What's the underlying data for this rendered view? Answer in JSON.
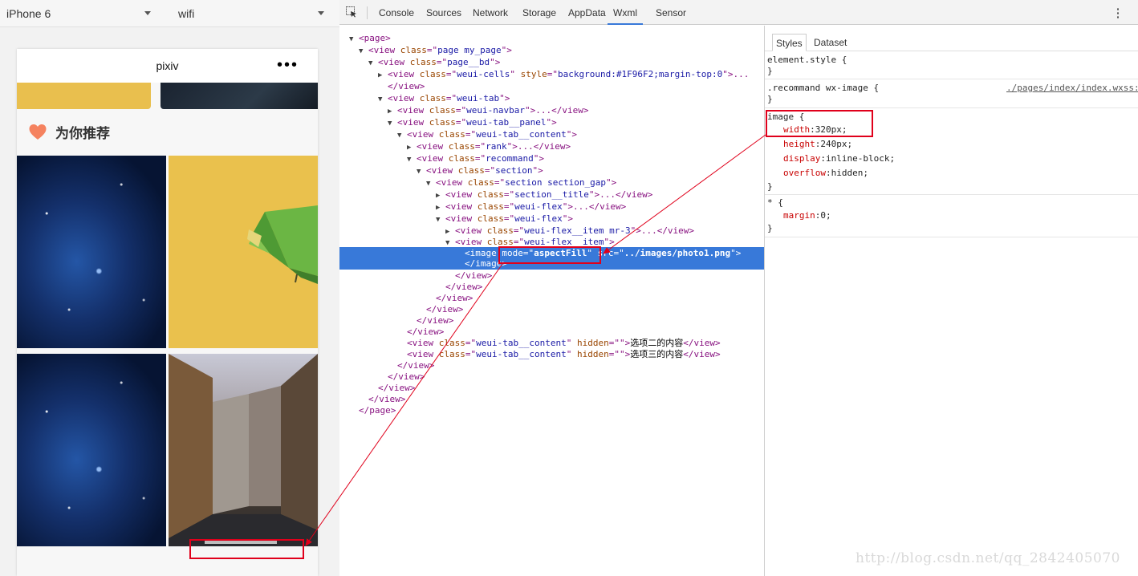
{
  "simulator": {
    "device": "iPhone 6",
    "network": "wifi",
    "page_title": "pixiv",
    "more_icon": "•••",
    "section_title": "为你推荐"
  },
  "devtools": {
    "tabs": [
      "Console",
      "Sources",
      "Network",
      "Storage",
      "AppData",
      "Wxml",
      "Sensor"
    ],
    "active_tab": "Wxml"
  },
  "wxml_tree": [
    {
      "indent": 0,
      "toggle": "▼",
      "parts": [
        [
          "tg",
          "<page>"
        ]
      ]
    },
    {
      "indent": 1,
      "toggle": "▼",
      "parts": [
        [
          "tg",
          "<view "
        ],
        [
          "an",
          "class"
        ],
        [
          "tg",
          "=\""
        ],
        [
          "av",
          "page my_page"
        ],
        [
          "tg",
          "\">"
        ]
      ]
    },
    {
      "indent": 2,
      "toggle": "▼",
      "parts": [
        [
          "tg",
          "<view "
        ],
        [
          "an",
          "class"
        ],
        [
          "tg",
          "=\""
        ],
        [
          "av",
          "page__bd"
        ],
        [
          "tg",
          "\">"
        ]
      ]
    },
    {
      "indent": 3,
      "toggle": "▶",
      "parts": [
        [
          "tg",
          "<view "
        ],
        [
          "an",
          "class"
        ],
        [
          "tg",
          "=\""
        ],
        [
          "av",
          "weui-cells"
        ],
        [
          "tg",
          "\" "
        ],
        [
          "an",
          "style"
        ],
        [
          "tg",
          "=\""
        ],
        [
          "av",
          "background:#1F96F2;margin-top:0"
        ],
        [
          "tg",
          "\">..."
        ]
      ]
    },
    {
      "indent": 3,
      "toggle": "",
      "parts": [
        [
          "tg",
          "</view>"
        ]
      ]
    },
    {
      "indent": 3,
      "toggle": "▼",
      "parts": [
        [
          "tg",
          "<view "
        ],
        [
          "an",
          "class"
        ],
        [
          "tg",
          "=\""
        ],
        [
          "av",
          "weui-tab"
        ],
        [
          "tg",
          "\">"
        ]
      ]
    },
    {
      "indent": 4,
      "toggle": "▶",
      "parts": [
        [
          "tg",
          "<view "
        ],
        [
          "an",
          "class"
        ],
        [
          "tg",
          "=\""
        ],
        [
          "av",
          "weui-navbar"
        ],
        [
          "tg",
          "\">...</view>"
        ]
      ]
    },
    {
      "indent": 4,
      "toggle": "▼",
      "parts": [
        [
          "tg",
          "<view "
        ],
        [
          "an",
          "class"
        ],
        [
          "tg",
          "=\""
        ],
        [
          "av",
          "weui-tab__panel"
        ],
        [
          "tg",
          "\">"
        ]
      ]
    },
    {
      "indent": 5,
      "toggle": "▼",
      "parts": [
        [
          "tg",
          "<view "
        ],
        [
          "an",
          "class"
        ],
        [
          "tg",
          "=\""
        ],
        [
          "av",
          "weui-tab__content"
        ],
        [
          "tg",
          "\">"
        ]
      ]
    },
    {
      "indent": 6,
      "toggle": "▶",
      "parts": [
        [
          "tg",
          "<view "
        ],
        [
          "an",
          "class"
        ],
        [
          "tg",
          "=\""
        ],
        [
          "av",
          "rank"
        ],
        [
          "tg",
          "\">...</view>"
        ]
      ]
    },
    {
      "indent": 6,
      "toggle": "▼",
      "parts": [
        [
          "tg",
          "<view "
        ],
        [
          "an",
          "class"
        ],
        [
          "tg",
          "=\""
        ],
        [
          "av",
          "recommand"
        ],
        [
          "tg",
          "\">"
        ]
      ]
    },
    {
      "indent": 7,
      "toggle": "▼",
      "parts": [
        [
          "tg",
          "<view "
        ],
        [
          "an",
          "class"
        ],
        [
          "tg",
          "=\""
        ],
        [
          "av",
          "section"
        ],
        [
          "tg",
          "\">"
        ]
      ]
    },
    {
      "indent": 8,
      "toggle": "▼",
      "parts": [
        [
          "tg",
          "<view "
        ],
        [
          "an",
          "class"
        ],
        [
          "tg",
          "=\""
        ],
        [
          "av",
          "section section_gap"
        ],
        [
          "tg",
          "\">"
        ]
      ]
    },
    {
      "indent": 9,
      "toggle": "▶",
      "parts": [
        [
          "tg",
          "<view "
        ],
        [
          "an",
          "class"
        ],
        [
          "tg",
          "=\""
        ],
        [
          "av",
          "section__title"
        ],
        [
          "tg",
          "\">...</view>"
        ]
      ]
    },
    {
      "indent": 9,
      "toggle": "▶",
      "parts": [
        [
          "tg",
          "<view "
        ],
        [
          "an",
          "class"
        ],
        [
          "tg",
          "=\""
        ],
        [
          "av",
          "weui-flex"
        ],
        [
          "tg",
          "\">...</view>"
        ]
      ]
    },
    {
      "indent": 9,
      "toggle": "▼",
      "parts": [
        [
          "tg",
          "<view "
        ],
        [
          "an",
          "class"
        ],
        [
          "tg",
          "=\""
        ],
        [
          "av",
          "weui-flex"
        ],
        [
          "tg",
          "\">"
        ]
      ]
    },
    {
      "indent": 10,
      "toggle": "▶",
      "parts": [
        [
          "tg",
          "<view "
        ],
        [
          "an",
          "class"
        ],
        [
          "tg",
          "=\""
        ],
        [
          "av",
          "weui-flex__item mr-3"
        ],
        [
          "tg",
          "\">...</view>"
        ]
      ]
    },
    {
      "indent": 10,
      "toggle": "▼",
      "parts": [
        [
          "tg",
          "<view "
        ],
        [
          "an",
          "class"
        ],
        [
          "tg",
          "=\""
        ],
        [
          "av",
          "weui-flex__item"
        ],
        [
          "tg",
          "\">"
        ]
      ]
    },
    {
      "indent": 11,
      "toggle": "",
      "selected": true,
      "parts": [
        [
          "tg",
          "<image "
        ],
        [
          "an",
          "mode"
        ],
        [
          "tg",
          "=\""
        ],
        [
          "av",
          "aspectFill"
        ],
        [
          "tg",
          "\" "
        ],
        [
          "an",
          "src"
        ],
        [
          "tg",
          "=\""
        ],
        [
          "av",
          "../images/photo1.png"
        ],
        [
          "tg",
          "\">"
        ]
      ],
      "second": [
        [
          "tg",
          "</image>"
        ]
      ]
    },
    {
      "indent": 10,
      "toggle": "",
      "parts": [
        [
          "tg",
          "</view>"
        ]
      ]
    },
    {
      "indent": 9,
      "toggle": "",
      "parts": [
        [
          "tg",
          "</view>"
        ]
      ]
    },
    {
      "indent": 8,
      "toggle": "",
      "parts": [
        [
          "tg",
          "</view>"
        ]
      ]
    },
    {
      "indent": 7,
      "toggle": "",
      "parts": [
        [
          "tg",
          "</view>"
        ]
      ]
    },
    {
      "indent": 6,
      "toggle": "",
      "parts": [
        [
          "tg",
          "</view>"
        ]
      ]
    },
    {
      "indent": 5,
      "toggle": "",
      "parts": [
        [
          "tg",
          "</view>"
        ]
      ]
    },
    {
      "indent": 5,
      "toggle": "",
      "parts": [
        [
          "tg",
          "<view "
        ],
        [
          "an",
          "class"
        ],
        [
          "tg",
          "=\""
        ],
        [
          "av",
          "weui-tab__content"
        ],
        [
          "tg",
          "\" "
        ],
        [
          "an",
          "hidden"
        ],
        [
          "tg",
          "=\"\">"
        ],
        [
          "tx",
          "选项二的内容"
        ],
        [
          "tg",
          "</view>"
        ]
      ]
    },
    {
      "indent": 5,
      "toggle": "",
      "parts": [
        [
          "tg",
          "<view "
        ],
        [
          "an",
          "class"
        ],
        [
          "tg",
          "=\""
        ],
        [
          "av",
          "weui-tab__content"
        ],
        [
          "tg",
          "\" "
        ],
        [
          "an",
          "hidden"
        ],
        [
          "tg",
          "=\"\">"
        ],
        [
          "tx",
          "选项三的内容"
        ],
        [
          "tg",
          "</view>"
        ]
      ]
    },
    {
      "indent": 4,
      "toggle": "",
      "parts": [
        [
          "tg",
          "</view>"
        ]
      ]
    },
    {
      "indent": 3,
      "toggle": "",
      "parts": [
        [
          "tg",
          "</view>"
        ]
      ]
    },
    {
      "indent": 2,
      "toggle": "",
      "parts": [
        [
          "tg",
          "</view>"
        ]
      ]
    },
    {
      "indent": 1,
      "toggle": "",
      "parts": [
        [
          "tg",
          "</view>"
        ]
      ]
    },
    {
      "indent": 0,
      "toggle": "",
      "parts": [
        [
          "tg",
          "</page>"
        ]
      ]
    }
  ],
  "styles_panel": {
    "tabs": [
      "Styles",
      "Dataset"
    ],
    "active_tab": "Styles",
    "rules": [
      {
        "selector": "element.style {",
        "decls": [],
        "close": "}"
      },
      {
        "selector": ".recommand wx-image {",
        "source": "./pages/index/index.wxss:",
        "decls": [],
        "close": "}"
      },
      {
        "selector": "image {",
        "decls": [
          [
            "width",
            "320px"
          ],
          [
            "height",
            "240px"
          ],
          [
            "display",
            "inline-block"
          ],
          [
            "overflow",
            "hidden"
          ]
        ],
        "close": "}"
      },
      {
        "selector": "* {",
        "decls": [
          [
            "margin",
            "0"
          ]
        ],
        "close": "}"
      }
    ]
  },
  "watermark": "http://blog.csdn.net/qq_2842405070"
}
